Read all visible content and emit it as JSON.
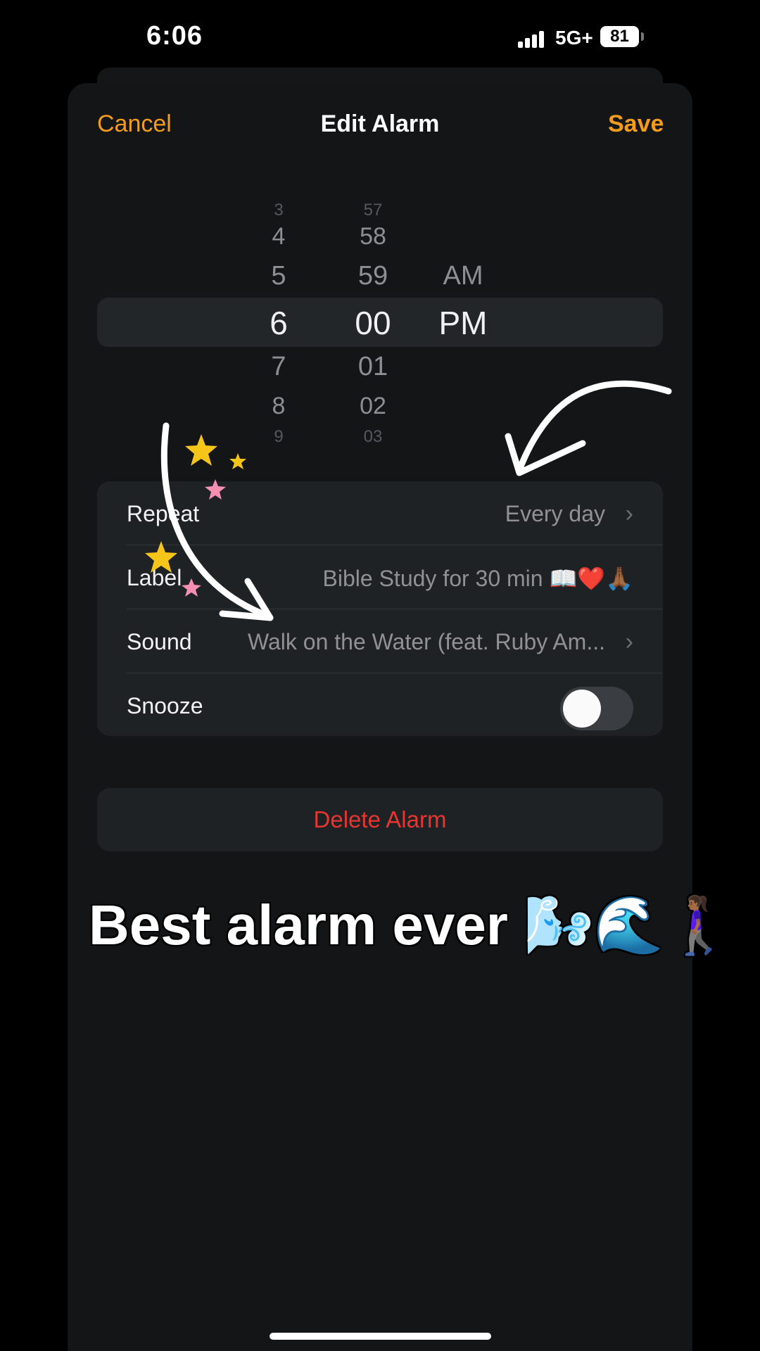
{
  "status_bar": {
    "time": "6:06",
    "network": "5G+",
    "battery": "81"
  },
  "nav": {
    "cancel_label": "Cancel",
    "title": "Edit Alarm",
    "save_label": "Save"
  },
  "picker": {
    "hours": [
      "3",
      "4",
      "5",
      "6",
      "7",
      "8",
      "9"
    ],
    "minutes": [
      "57",
      "58",
      "59",
      "00",
      "01",
      "02",
      "03"
    ],
    "periods": [
      "AM",
      "PM"
    ],
    "selected": {
      "hour": "6",
      "minute": "00",
      "period": "PM"
    }
  },
  "settings": {
    "repeat_label": "Repeat",
    "repeat_value": "Every day",
    "label_label": "Label",
    "label_value": "Bible Study for 30 min 📖❤️🙏🏾",
    "sound_label": "Sound",
    "sound_value": "Walk on the Water (feat. Ruby Am...",
    "snooze_label": "Snooze",
    "snooze_enabled": false
  },
  "delete_label": "Delete Alarm",
  "caption": "Best alarm ever 🌬️🌊🚶🏾‍♀️",
  "colors": {
    "accent": "#f39b1b",
    "destructive": "#e8352f",
    "background": "#000000",
    "sheet": "#131517",
    "card": "#1f2225"
  }
}
